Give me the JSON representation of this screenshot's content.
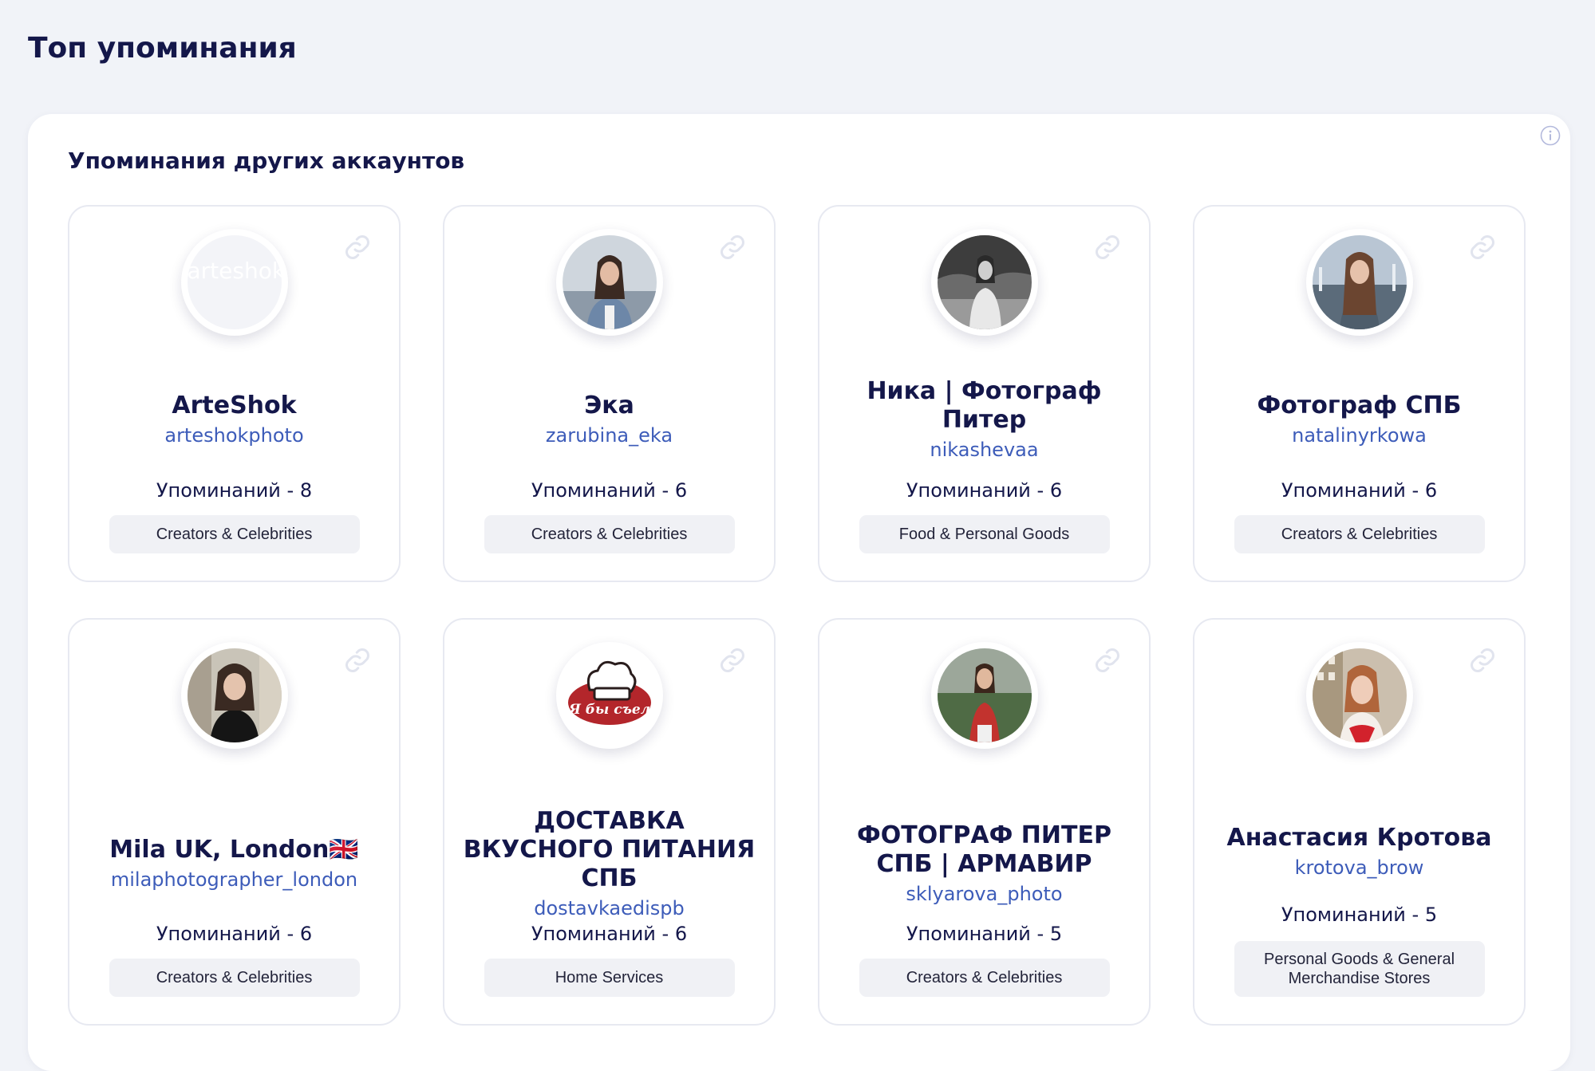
{
  "page_title": "Топ упоминания",
  "section_title": "Упоминания других аккаунтов",
  "icons": {
    "info": "info-icon",
    "link": "link-icon"
  },
  "colors": {
    "title": "#14174a",
    "handle": "#3d5cb9",
    "tag_bg": "#f0f1f5",
    "page_bg": "#f1f3f8"
  },
  "accounts": [
    {
      "name": "ArteShok",
      "handle": "arteshokphoto",
      "mentions": "Упоминаний - 8",
      "category": "Creators & Celebrities",
      "avatar_text": "arteshok"
    },
    {
      "name": "Эка",
      "handle": "zarubina_eka",
      "mentions": "Упоминаний - 6",
      "category": "Creators & Celebrities"
    },
    {
      "name": "Ника | Фотограф Питер",
      "handle": "nikashevaa",
      "mentions": "Упоминаний - 6",
      "category": "Food & Personal Goods"
    },
    {
      "name": "Фотограф СПБ",
      "handle": "natalinyrkowa",
      "mentions": "Упоминаний - 6",
      "category": "Creators & Celebrities"
    },
    {
      "name": "Mila UK, London🇬🇧",
      "handle": "milaphotographer_london",
      "mentions": "Упоминаний - 6",
      "category": "Creators & Celebrities"
    },
    {
      "name": "ДОСТАВКА ВКУСНОГО ПИТАНИЯ СПБ",
      "handle": "dostavkaedispb",
      "mentions": "Упоминаний - 6",
      "category": "Home Services",
      "logo_text": "Я бы съел"
    },
    {
      "name": "ФОТОГРАФ ПИТЕР СПБ | АРМАВИР",
      "handle": "sklyarova_photo",
      "mentions": "Упоминаний - 5",
      "category": "Creators & Celebrities"
    },
    {
      "name": "Анастасия Кротова",
      "handle": "krotova_brow",
      "mentions": "Упоминаний - 5",
      "category": "Personal Goods & General Merchandise Stores"
    }
  ]
}
